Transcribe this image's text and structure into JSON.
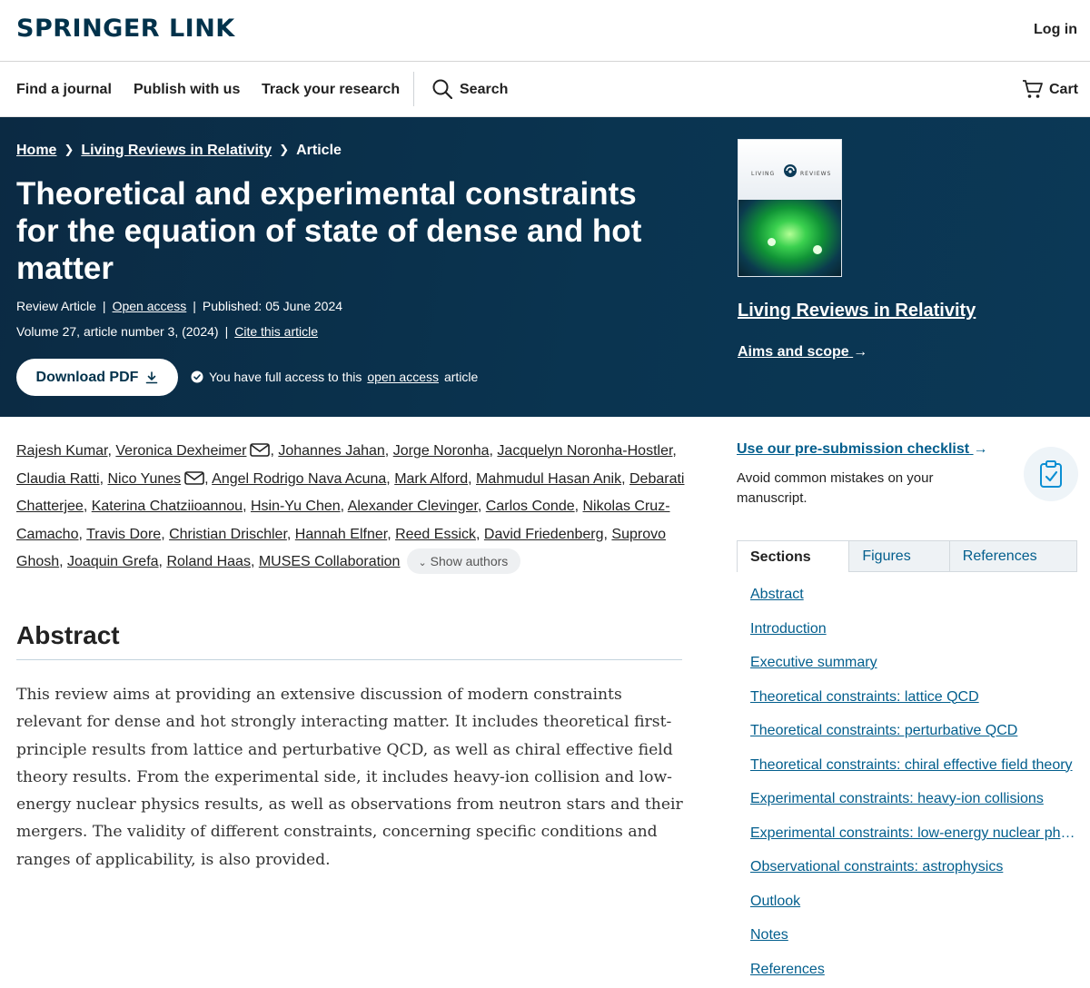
{
  "brand": {
    "logo": "SPRINGER LINK",
    "login": "Log in"
  },
  "nav": {
    "items": [
      "Find a journal",
      "Publish with us",
      "Track your research"
    ],
    "search": "Search",
    "cart": "Cart"
  },
  "breadcrumb": {
    "home": "Home",
    "journal": "Living Reviews in Relativity",
    "current": "Article"
  },
  "article": {
    "title": "Theoretical and experimental constraints for the equation of state of dense and hot matter",
    "type": "Review Article",
    "access": "Open access",
    "published": "Published: 05 June 2024",
    "volume": "Volume 27, article number 3, (2024)",
    "cite": "Cite this article",
    "download": "Download PDF",
    "access_note_prefix": "You have full access to this",
    "access_note_link": "open access",
    "access_note_suffix": "article"
  },
  "journal": {
    "name": "Living Reviews in Relativity",
    "aims": "Aims and scope",
    "cover_left": "LIVING",
    "cover_right": "REVIEWS"
  },
  "authors": {
    "list": [
      "Rajesh Kumar",
      "Veronica Dexheimer",
      "Johannes Jahan",
      "Jorge Noronha",
      "Jacquelyn Noronha-Hostler",
      "Claudia Ratti",
      "Nico Yunes",
      "Angel Rodrigo Nava Acuna",
      "Mark Alford",
      "Mahmudul Hasan Anik",
      "Debarati Chatterjee",
      "Katerina Chatziioannou",
      "Hsin-Yu Chen",
      "Alexander Clevinger",
      "Carlos Conde",
      "Nikolas Cruz-Camacho",
      "Travis Dore",
      "Christian Drischler",
      "Hannah Elfner",
      "Reed Essick",
      "David Friedenberg",
      "Suprovo Ghosh",
      "Joaquin Grefa",
      "Roland Haas",
      "MUSES Collaboration"
    ],
    "show_more": "Show authors"
  },
  "abstract": {
    "heading": "Abstract",
    "text": "This review aims at providing an extensive discussion of modern constraints relevant for dense and hot strongly interacting matter. It includes theoretical first-principle results from lattice and perturbative QCD, as well as chiral effective field theory results. From the experimental side, it includes heavy-ion collision and low-energy nuclear physics results, as well as observations from neutron stars and their mergers. The validity of different constraints, concerning specific conditions and ranges of applicability, is also provided."
  },
  "sidebar": {
    "checklist": "Use our pre-submission checklist",
    "checklist_desc": "Avoid common mistakes on your manuscript.",
    "tabs": [
      "Sections",
      "Figures",
      "References"
    ],
    "sections": [
      "Abstract",
      "Introduction",
      "Executive summary",
      "Theoretical constraints: lattice QCD",
      "Theoretical constraints: perturbative QCD",
      "Theoretical constraints: chiral effective field theory",
      "Experimental constraints: heavy-ion collisions",
      "Experimental constraints: low-energy nuclear physics",
      "Observational constraints: astrophysics",
      "Outlook",
      "Notes",
      "References"
    ]
  },
  "colors": {
    "brand": "#01324b",
    "hero_bg": "#0a3450",
    "link": "#025e8d"
  }
}
